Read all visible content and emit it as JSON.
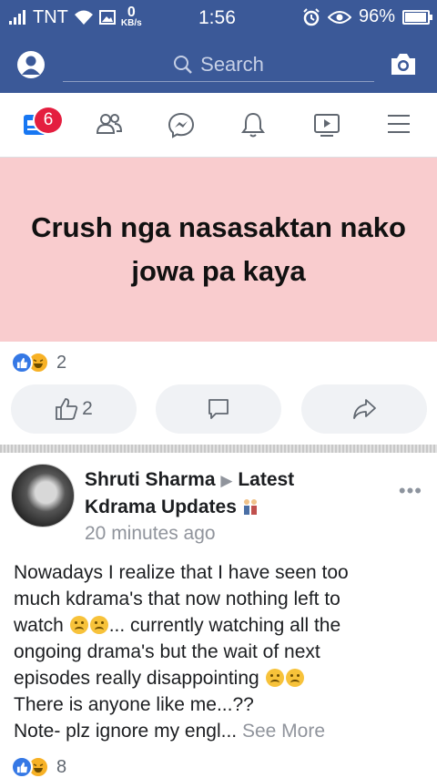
{
  "status_bar": {
    "carrier": "TNT",
    "speed_value": "0",
    "speed_unit": "KB/s",
    "time": "1:56",
    "battery": "96%",
    "battery_level": 0.96
  },
  "header": {
    "search_placeholder": "Search"
  },
  "nav": {
    "notification_count": "6",
    "tabs": [
      "feed",
      "friends",
      "messenger",
      "notifications",
      "watch",
      "menu"
    ]
  },
  "status_post": {
    "text_line1": "Crush nga nasasaktan nako",
    "text_line2": "jowa pa kaya",
    "reaction_count": "2",
    "like_count": "2"
  },
  "post": {
    "author": "Shruti Sharma",
    "group": "Latest",
    "group_line2": "Kdrama Updates",
    "time": "20 minutes ago",
    "body_line1": "Nowadays I realize that I have seen too",
    "body_line2": "much kdrama's that now  nothing left to",
    "body_line3_a": "watch",
    "body_line3_b": "... currently watching all the",
    "body_line4": "ongoing drama's but the wait of next",
    "body_line5": "episodes really disappointing",
    "body_line6": "There is anyone like me...??",
    "body_line7": "Note- plz ignore my engl...",
    "see_more": "See More",
    "reaction_count": "8"
  },
  "colors": {
    "brand": "#3b5998",
    "badge": "#e41e3f",
    "status_bg": "#f9ccce"
  }
}
